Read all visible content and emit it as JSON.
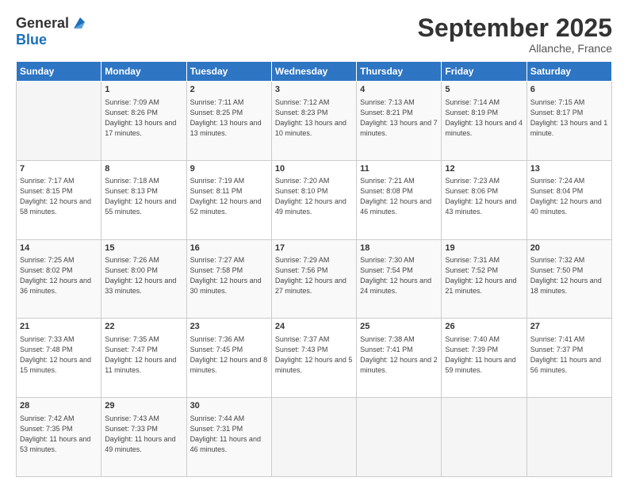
{
  "logo": {
    "general": "General",
    "blue": "Blue"
  },
  "title": "September 2025",
  "location": "Allanche, France",
  "days_header": [
    "Sunday",
    "Monday",
    "Tuesday",
    "Wednesday",
    "Thursday",
    "Friday",
    "Saturday"
  ],
  "weeks": [
    [
      {
        "day": "",
        "sunrise": "",
        "sunset": "",
        "daylight": ""
      },
      {
        "day": "1",
        "sunrise": "Sunrise: 7:09 AM",
        "sunset": "Sunset: 8:26 PM",
        "daylight": "Daylight: 13 hours and 17 minutes."
      },
      {
        "day": "2",
        "sunrise": "Sunrise: 7:11 AM",
        "sunset": "Sunset: 8:25 PM",
        "daylight": "Daylight: 13 hours and 13 minutes."
      },
      {
        "day": "3",
        "sunrise": "Sunrise: 7:12 AM",
        "sunset": "Sunset: 8:23 PM",
        "daylight": "Daylight: 13 hours and 10 minutes."
      },
      {
        "day": "4",
        "sunrise": "Sunrise: 7:13 AM",
        "sunset": "Sunset: 8:21 PM",
        "daylight": "Daylight: 13 hours and 7 minutes."
      },
      {
        "day": "5",
        "sunrise": "Sunrise: 7:14 AM",
        "sunset": "Sunset: 8:19 PM",
        "daylight": "Daylight: 13 hours and 4 minutes."
      },
      {
        "day": "6",
        "sunrise": "Sunrise: 7:15 AM",
        "sunset": "Sunset: 8:17 PM",
        "daylight": "Daylight: 13 hours and 1 minute."
      }
    ],
    [
      {
        "day": "7",
        "sunrise": "Sunrise: 7:17 AM",
        "sunset": "Sunset: 8:15 PM",
        "daylight": "Daylight: 12 hours and 58 minutes."
      },
      {
        "day": "8",
        "sunrise": "Sunrise: 7:18 AM",
        "sunset": "Sunset: 8:13 PM",
        "daylight": "Daylight: 12 hours and 55 minutes."
      },
      {
        "day": "9",
        "sunrise": "Sunrise: 7:19 AM",
        "sunset": "Sunset: 8:11 PM",
        "daylight": "Daylight: 12 hours and 52 minutes."
      },
      {
        "day": "10",
        "sunrise": "Sunrise: 7:20 AM",
        "sunset": "Sunset: 8:10 PM",
        "daylight": "Daylight: 12 hours and 49 minutes."
      },
      {
        "day": "11",
        "sunrise": "Sunrise: 7:21 AM",
        "sunset": "Sunset: 8:08 PM",
        "daylight": "Daylight: 12 hours and 46 minutes."
      },
      {
        "day": "12",
        "sunrise": "Sunrise: 7:23 AM",
        "sunset": "Sunset: 8:06 PM",
        "daylight": "Daylight: 12 hours and 43 minutes."
      },
      {
        "day": "13",
        "sunrise": "Sunrise: 7:24 AM",
        "sunset": "Sunset: 8:04 PM",
        "daylight": "Daylight: 12 hours and 40 minutes."
      }
    ],
    [
      {
        "day": "14",
        "sunrise": "Sunrise: 7:25 AM",
        "sunset": "Sunset: 8:02 PM",
        "daylight": "Daylight: 12 hours and 36 minutes."
      },
      {
        "day": "15",
        "sunrise": "Sunrise: 7:26 AM",
        "sunset": "Sunset: 8:00 PM",
        "daylight": "Daylight: 12 hours and 33 minutes."
      },
      {
        "day": "16",
        "sunrise": "Sunrise: 7:27 AM",
        "sunset": "Sunset: 7:58 PM",
        "daylight": "Daylight: 12 hours and 30 minutes."
      },
      {
        "day": "17",
        "sunrise": "Sunrise: 7:29 AM",
        "sunset": "Sunset: 7:56 PM",
        "daylight": "Daylight: 12 hours and 27 minutes."
      },
      {
        "day": "18",
        "sunrise": "Sunrise: 7:30 AM",
        "sunset": "Sunset: 7:54 PM",
        "daylight": "Daylight: 12 hours and 24 minutes."
      },
      {
        "day": "19",
        "sunrise": "Sunrise: 7:31 AM",
        "sunset": "Sunset: 7:52 PM",
        "daylight": "Daylight: 12 hours and 21 minutes."
      },
      {
        "day": "20",
        "sunrise": "Sunrise: 7:32 AM",
        "sunset": "Sunset: 7:50 PM",
        "daylight": "Daylight: 12 hours and 18 minutes."
      }
    ],
    [
      {
        "day": "21",
        "sunrise": "Sunrise: 7:33 AM",
        "sunset": "Sunset: 7:48 PM",
        "daylight": "Daylight: 12 hours and 15 minutes."
      },
      {
        "day": "22",
        "sunrise": "Sunrise: 7:35 AM",
        "sunset": "Sunset: 7:47 PM",
        "daylight": "Daylight: 12 hours and 11 minutes."
      },
      {
        "day": "23",
        "sunrise": "Sunrise: 7:36 AM",
        "sunset": "Sunset: 7:45 PM",
        "daylight": "Daylight: 12 hours and 8 minutes."
      },
      {
        "day": "24",
        "sunrise": "Sunrise: 7:37 AM",
        "sunset": "Sunset: 7:43 PM",
        "daylight": "Daylight: 12 hours and 5 minutes."
      },
      {
        "day": "25",
        "sunrise": "Sunrise: 7:38 AM",
        "sunset": "Sunset: 7:41 PM",
        "daylight": "Daylight: 12 hours and 2 minutes."
      },
      {
        "day": "26",
        "sunrise": "Sunrise: 7:40 AM",
        "sunset": "Sunset: 7:39 PM",
        "daylight": "Daylight: 11 hours and 59 minutes."
      },
      {
        "day": "27",
        "sunrise": "Sunrise: 7:41 AM",
        "sunset": "Sunset: 7:37 PM",
        "daylight": "Daylight: 11 hours and 56 minutes."
      }
    ],
    [
      {
        "day": "28",
        "sunrise": "Sunrise: 7:42 AM",
        "sunset": "Sunset: 7:35 PM",
        "daylight": "Daylight: 11 hours and 53 minutes."
      },
      {
        "day": "29",
        "sunrise": "Sunrise: 7:43 AM",
        "sunset": "Sunset: 7:33 PM",
        "daylight": "Daylight: 11 hours and 49 minutes."
      },
      {
        "day": "30",
        "sunrise": "Sunrise: 7:44 AM",
        "sunset": "Sunset: 7:31 PM",
        "daylight": "Daylight: 11 hours and 46 minutes."
      },
      {
        "day": "",
        "sunrise": "",
        "sunset": "",
        "daylight": ""
      },
      {
        "day": "",
        "sunrise": "",
        "sunset": "",
        "daylight": ""
      },
      {
        "day": "",
        "sunrise": "",
        "sunset": "",
        "daylight": ""
      },
      {
        "day": "",
        "sunrise": "",
        "sunset": "",
        "daylight": ""
      }
    ]
  ]
}
